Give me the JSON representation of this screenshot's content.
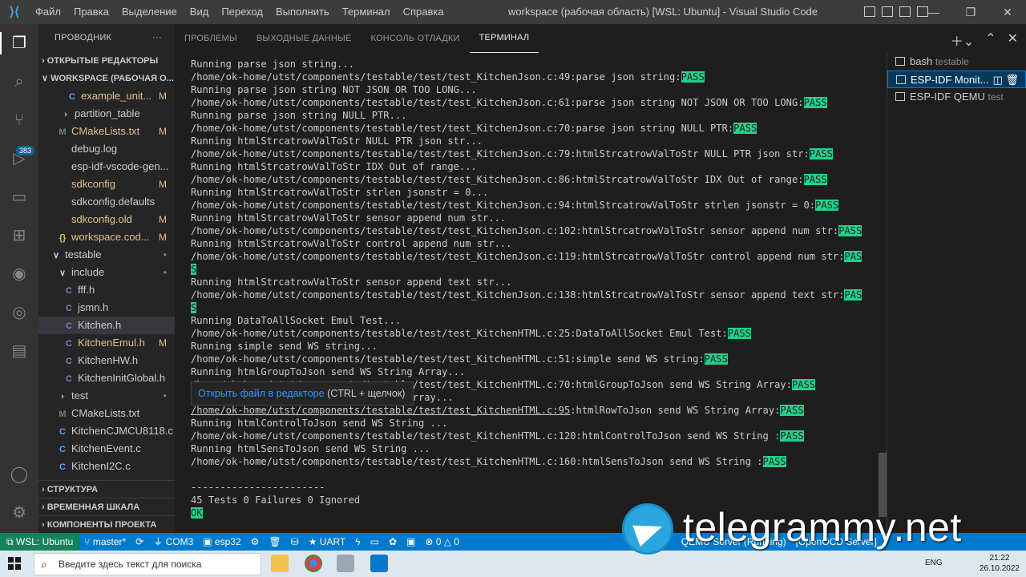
{
  "titlebar": {
    "menu": [
      "Файл",
      "Правка",
      "Выделение",
      "Вид",
      "Переход",
      "Выполнить",
      "Терминал",
      "Справка"
    ],
    "title": "workspace (рабочая область) [WSL: Ubuntu] - Visual Studio Code"
  },
  "activity": {
    "badge": "383"
  },
  "sidebar": {
    "title": "ПРОВОДНИК",
    "open_editors": "ОТКРЫТЫЕ РЕДАКТОРЫ",
    "workspace": "WORKSPACE (РАБОЧАЯ О...",
    "items": [
      {
        "icon": "C",
        "label": "example_unit...",
        "status": "M",
        "color": "#e2c08d",
        "iconColor": "#599eff",
        "indent": 34
      },
      {
        "icon": "›",
        "label": "partition_table",
        "status": "",
        "color": "#cccccc",
        "iconColor": "#cccccc",
        "indent": 26
      },
      {
        "icon": "M",
        "label": "CMakeLists.txt",
        "status": "M",
        "color": "#e2c08d",
        "iconColor": "#6d8086",
        "indent": 22
      },
      {
        "icon": "",
        "label": "debug.log",
        "status": "",
        "color": "#cccccc",
        "iconColor": "#cccccc",
        "indent": 22
      },
      {
        "icon": "",
        "label": "esp-idf-vscode-gen...",
        "status": "",
        "color": "#cccccc",
        "iconColor": "#cccccc",
        "indent": 22
      },
      {
        "icon": "",
        "label": "sdkconfig",
        "status": "M",
        "color": "#e2c08d",
        "iconColor": "#cccccc",
        "indent": 22
      },
      {
        "icon": "",
        "label": "sdkconfig.defaults",
        "status": "",
        "color": "#cccccc",
        "iconColor": "#cccccc",
        "indent": 22
      },
      {
        "icon": "",
        "label": "sdkconfig.old",
        "status": "M",
        "color": "#e2c08d",
        "iconColor": "#cccccc",
        "indent": 22
      },
      {
        "icon": "{}",
        "label": "workspace.cod...",
        "status": "M",
        "color": "#e2c08d",
        "iconColor": "#cbcb41",
        "indent": 22
      },
      {
        "icon": "∨",
        "label": "testable",
        "status": "•",
        "color": "#cccccc",
        "iconColor": "#cccccc",
        "indent": 14
      },
      {
        "icon": "∨",
        "label": "include",
        "status": "•",
        "color": "#cccccc",
        "iconColor": "#cccccc",
        "indent": 22
      },
      {
        "icon": "C",
        "label": "fff.h",
        "status": "",
        "color": "#cccccc",
        "iconColor": "#a074c4",
        "indent": 30
      },
      {
        "icon": "C",
        "label": "jsmn.h",
        "status": "",
        "color": "#cccccc",
        "iconColor": "#a074c4",
        "indent": 30
      },
      {
        "icon": "C",
        "label": "Kitchen.h",
        "status": "",
        "color": "#cccccc",
        "iconColor": "#a074c4",
        "indent": 30,
        "selected": true
      },
      {
        "icon": "C",
        "label": "KitchenEmul.h",
        "status": "M",
        "color": "#e2c08d",
        "iconColor": "#a074c4",
        "indent": 30
      },
      {
        "icon": "C",
        "label": "KitchenHW.h",
        "status": "",
        "color": "#cccccc",
        "iconColor": "#a074c4",
        "indent": 30
      },
      {
        "icon": "C",
        "label": "KitchenInitGlobal.h",
        "status": "",
        "color": "#cccccc",
        "iconColor": "#a074c4",
        "indent": 30
      },
      {
        "icon": "›",
        "label": "test",
        "status": "•",
        "color": "#cccccc",
        "iconColor": "#cccccc",
        "indent": 22
      },
      {
        "icon": "M",
        "label": "CMakeLists.txt",
        "status": "",
        "color": "#cccccc",
        "iconColor": "#6d8086",
        "indent": 22
      },
      {
        "icon": "C",
        "label": "KitchenCJMCU8118.c",
        "status": "",
        "color": "#cccccc",
        "iconColor": "#599eff",
        "indent": 22
      },
      {
        "icon": "C",
        "label": "KitchenEvent.c",
        "status": "",
        "color": "#cccccc",
        "iconColor": "#599eff",
        "indent": 22
      },
      {
        "icon": "C",
        "label": "KitchenI2C.c",
        "status": "",
        "color": "#cccccc",
        "iconColor": "#599eff",
        "indent": 22
      }
    ],
    "bottom_sections": [
      "СТРУКТУРА",
      "ВРЕМЕННАЯ ШКАЛА",
      "КОМПОНЕНТЫ ПРОЕКТА"
    ]
  },
  "panel": {
    "tabs": [
      "ПРОБЛЕМЫ",
      "ВЫХОДНЫЕ ДАННЫЕ",
      "КОНСОЛЬ ОТЛАДКИ",
      "ТЕРМИНАЛ"
    ],
    "active_tab": 3
  },
  "terminal": {
    "lines": [
      {
        "t": "Running parse json string..."
      },
      {
        "t": "/home/ok-home/utst/components/testable/test/test_KitchenJson.c:49:parse json string:",
        "p": "PASS"
      },
      {
        "t": "Running parse json string NOT JSON OR TOO LONG..."
      },
      {
        "t": "/home/ok-home/utst/components/testable/test/test_KitchenJson.c:61:parse json string NOT JSON OR TOO LONG:",
        "p": "PASS"
      },
      {
        "t": "Running parse json string NULL PTR..."
      },
      {
        "t": "/home/ok-home/utst/components/testable/test/test_KitchenJson.c:70:parse json string NULL PTR:",
        "p": "PASS"
      },
      {
        "t": "Running htmlStrcatrowValToStr NULL PTR json str..."
      },
      {
        "t": "/home/ok-home/utst/components/testable/test/test_KitchenJson.c:79:htmlStrcatrowValToStr NULL PTR json str:",
        "p": "PASS"
      },
      {
        "t": "Running htmlStrcatrowValToStr IDX Out of range..."
      },
      {
        "t": "/home/ok-home/utst/components/testable/test/test_KitchenJson.c:86:htmlStrcatrowValToStr IDX Out of range:",
        "p": "PASS"
      },
      {
        "t": "Running htmlStrcatrowValToStr strlen jsonstr = 0..."
      },
      {
        "t": "/home/ok-home/utst/components/testable/test/test_KitchenJson.c:94:htmlStrcatrowValToStr strlen jsonstr = 0:",
        "p": "PASS"
      },
      {
        "t": "Running htmlStrcatrowValToStr sensor append num str..."
      },
      {
        "t": "/home/ok-home/utst/components/testable/test/test_KitchenJson.c:102:htmlStrcatrowValToStr sensor append num str:",
        "p": "PASS"
      },
      {
        "t": "Running htmlStrcatrowValToStr control append num str..."
      },
      {
        "t": "/home/ok-home/utst/components/testable/test/test_KitchenJson.c:119:htmlStrcatrowValToStr control append num str:",
        "p": "PAS"
      },
      {
        "t": "",
        "p": "S"
      },
      {
        "t": "Running htmlStrcatrowValToStr sensor append text str..."
      },
      {
        "t": "/home/ok-home/utst/components/testable/test/test_KitchenJson.c:138:htmlStrcatrowValToStr sensor append text str:",
        "p": "PAS"
      },
      {
        "t": "",
        "p": "S"
      },
      {
        "t": "Running DataToAllSocket Emul Test..."
      },
      {
        "t": "/home/ok-home/utst/components/testable/test/test_KitchenHTML.c:25:DataToAllSocket Emul Test:",
        "p": "PASS"
      },
      {
        "t": "Running simple send WS string..."
      },
      {
        "t": "/home/ok-home/utst/components/testable/test/test_KitchenHTML.c:51:simple send WS string:",
        "p": "PASS"
      },
      {
        "t": "Running htmlGroupToJson send WS String Array..."
      },
      {
        "t": "/home/ok-home/utst/components/testable/test/test_KitchenHTML.c:70:htmlGroupToJson send WS String Array:",
        "p": "PASS"
      },
      {
        "t": "Running htmlRowToJson send WS String Array..."
      },
      {
        "t": "/home/ok-home/utst/components/testable/test/test_KitchenHTML.c:95",
        "link": true,
        "t2": ":htmlRowToJson send WS String Array:",
        "p": "PASS"
      },
      {
        "t": "Running htmlControlToJson send WS String ..."
      },
      {
        "t": "/home/ok-home/utst/components/testable/test/test_KitchenHTML.c:120:htmlControlToJson send WS String :",
        "p": "PASS"
      },
      {
        "t": "Running htmlSensToJson send WS String ..."
      },
      {
        "t": "/home/ok-home/utst/components/testable/test/test_KitchenHTML.c:160:htmlSensToJson send WS String :",
        "p": "PASS"
      },
      {
        "t": ""
      },
      {
        "t": "-----------------------"
      },
      {
        "t": "45 Tests 0 Failures 0 Ignored"
      },
      {
        "t": "",
        "p": "OK"
      }
    ],
    "tooltip_link": "Открыть файл в редакторе",
    "tooltip_hint": " (CTRL + щелчок)"
  },
  "terminal_list": [
    {
      "name": "bash",
      "desc": "testable"
    },
    {
      "name": "ESP-IDF Monit...",
      "desc": "",
      "selected": true
    },
    {
      "name": "ESP-IDF QEMU",
      "desc": "test"
    }
  ],
  "statusbar": {
    "remote": "WSL: Ubuntu",
    "branch": "master*",
    "port": "COM3",
    "target": "esp32",
    "uart": "UART",
    "problems": "0 △ 0",
    "qemu": "QEMU Server (Running)",
    "ocd": "[OpenOCD Server]"
  },
  "taskbar": {
    "search_placeholder": "Введите здесь текст для поиска",
    "lang": "ENG",
    "time": "21:22",
    "date": "26.10.2022"
  },
  "watermark": "telegrammy.net"
}
